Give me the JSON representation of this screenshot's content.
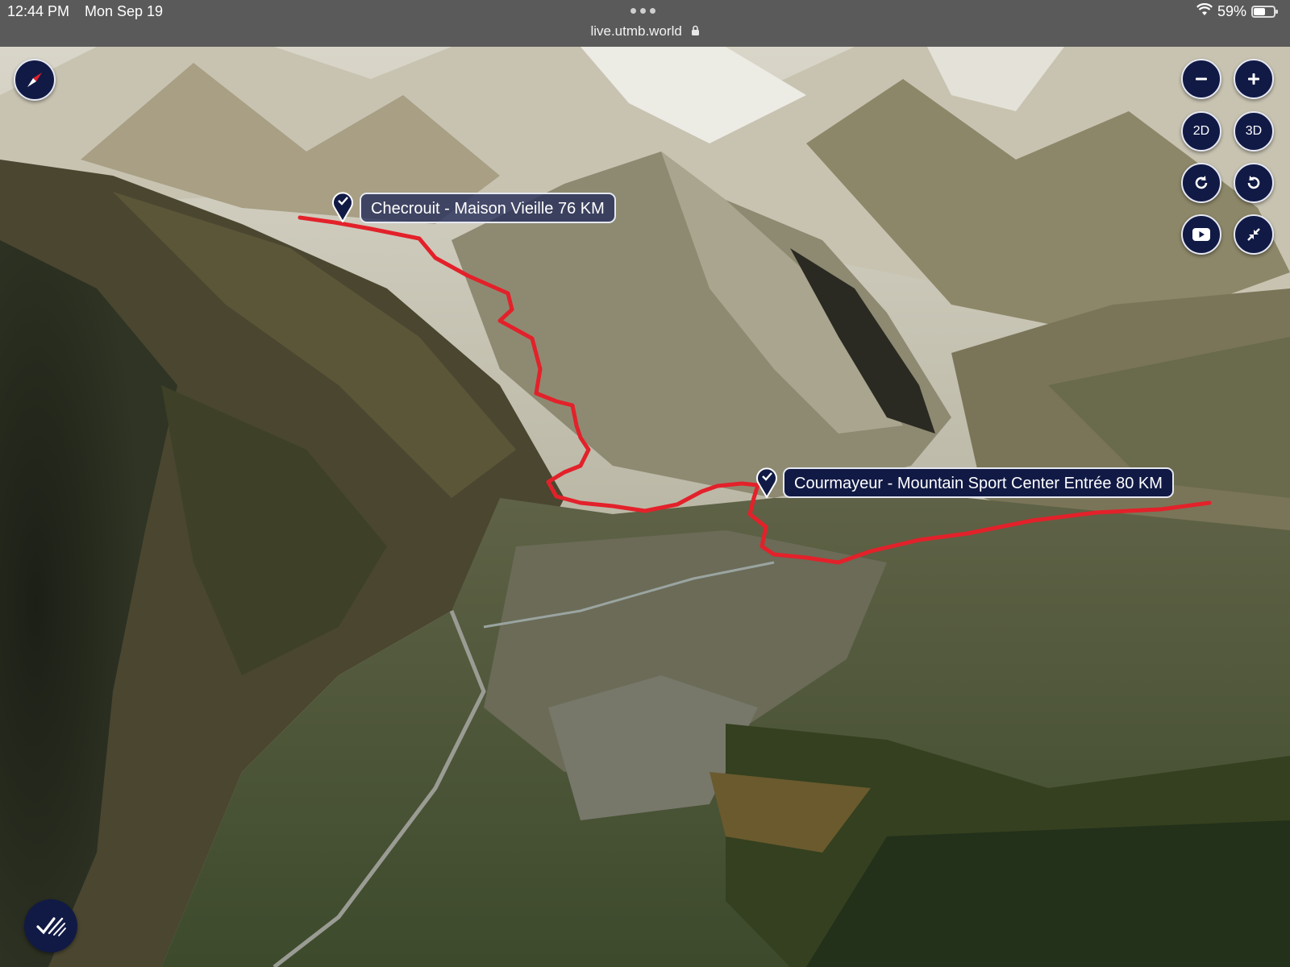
{
  "status_bar": {
    "time": "12:44 PM",
    "date": "Mon Sep 19",
    "url": "live.utmb.world",
    "battery_percent": "59%",
    "battery_level": 0.59,
    "wifi_icon": "wifi-icon",
    "lock_icon": "lock-icon"
  },
  "map": {
    "route_color": "#e3212a",
    "waypoints": [
      {
        "label": "Checrouit - Maison Vieille 76 KM",
        "icon": "checkpoint-pin-icon"
      },
      {
        "label": "Courmayeur - Mountain Sport Center Entrée 80 KM",
        "icon": "checkpoint-pin-icon"
      }
    ]
  },
  "controls": {
    "compass_icon": "compass-icon",
    "zoom_out_icon": "minus-icon",
    "zoom_in_icon": "plus-icon",
    "view_2d": "2D",
    "view_3d": "3D",
    "rotate_cw_icon": "rotate-clockwise-icon",
    "rotate_ccw_icon": "rotate-counterclockwise-icon",
    "video_icon": "video-play-icon",
    "collapse_icon": "collapse-icon",
    "tracking_icon": "tracking-check-icon",
    "accent": "#111a45"
  }
}
